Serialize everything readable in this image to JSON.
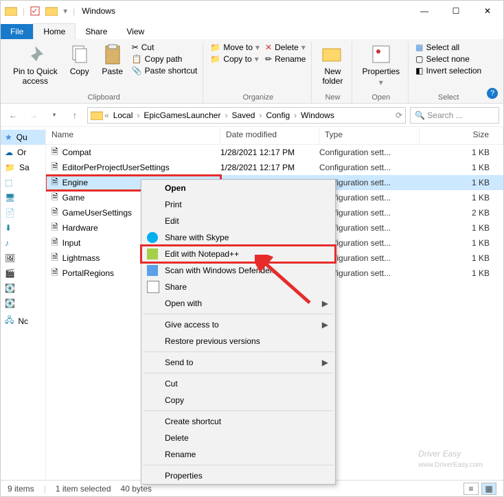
{
  "window": {
    "title": "Windows"
  },
  "tabs": {
    "file": "File",
    "home": "Home",
    "share": "Share",
    "view": "View"
  },
  "ribbon": {
    "clipboard": {
      "label": "Clipboard",
      "pin": "Pin to Quick\naccess",
      "copy": "Copy",
      "paste": "Paste",
      "cut": "Cut",
      "copypath": "Copy path",
      "pasteshort": "Paste shortcut"
    },
    "organize": {
      "label": "Organize",
      "moveto": "Move to",
      "copyto": "Copy to",
      "delete": "Delete",
      "rename": "Rename"
    },
    "new": {
      "label": "New",
      "newfolder": "New\nfolder"
    },
    "open": {
      "label": "Open",
      "properties": "Properties"
    },
    "select": {
      "label": "Select",
      "all": "Select all",
      "none": "Select none",
      "invert": "Invert selection"
    }
  },
  "breadcrumb": [
    "Local",
    "EpicGamesLauncher",
    "Saved",
    "Config",
    "Windows"
  ],
  "search_placeholder": "Search ...",
  "columns": {
    "name": "Name",
    "date": "Date modified",
    "type": "Type",
    "size": "Size"
  },
  "nav": [
    "Qu",
    "Or",
    "Sa",
    "",
    "",
    "",
    "",
    "",
    "",
    "",
    "",
    "",
    "Nc"
  ],
  "files": [
    {
      "name": "Compat",
      "date": "1/28/2021 12:17 PM",
      "type": "Configuration sett...",
      "size": "1 KB"
    },
    {
      "name": "EditorPerProjectUserSettings",
      "date": "1/28/2021 12:17 PM",
      "type": "Configuration sett...",
      "size": "1 KB"
    },
    {
      "name": "Engine",
      "date": "",
      "type": "Configuration sett...",
      "size": "1 KB",
      "selected": true
    },
    {
      "name": "Game",
      "date": "",
      "type": "Configuration sett...",
      "size": "1 KB"
    },
    {
      "name": "GameUserSettings",
      "date": "",
      "type": "Configuration sett...",
      "size": "2 KB"
    },
    {
      "name": "Hardware",
      "date": "",
      "type": "Configuration sett...",
      "size": "1 KB"
    },
    {
      "name": "Input",
      "date": "",
      "type": "Configuration sett...",
      "size": "1 KB"
    },
    {
      "name": "Lightmass",
      "date": "",
      "type": "Configuration sett...",
      "size": "1 KB"
    },
    {
      "name": "PortalRegions",
      "date": "",
      "type": "Configuration sett...",
      "size": "1 KB"
    }
  ],
  "context_menu": [
    {
      "label": "Open",
      "bold": true
    },
    {
      "label": "Print"
    },
    {
      "label": "Edit"
    },
    {
      "label": "Share with Skype",
      "cls": "icon skype"
    },
    {
      "label": "Edit with Notepad++",
      "cls": "icon npp",
      "highlight": true
    },
    {
      "label": "Scan with Windows Defender...",
      "cls": "icon def"
    },
    {
      "label": "Share",
      "cls": "icon share"
    },
    {
      "label": "Open with",
      "sub": true
    },
    {
      "sep": true
    },
    {
      "label": "Give access to",
      "sub": true
    },
    {
      "label": "Restore previous versions"
    },
    {
      "sep": true
    },
    {
      "label": "Send to",
      "sub": true
    },
    {
      "sep": true
    },
    {
      "label": "Cut"
    },
    {
      "label": "Copy"
    },
    {
      "sep": true
    },
    {
      "label": "Create shortcut"
    },
    {
      "label": "Delete"
    },
    {
      "label": "Rename"
    },
    {
      "sep": true
    },
    {
      "label": "Properties"
    }
  ],
  "status": {
    "items": "9 items",
    "sel": "1 item selected",
    "bytes": "40 bytes"
  },
  "watermark": {
    "brand": "Driver Easy",
    "url": "www.DriverEasy.com"
  }
}
